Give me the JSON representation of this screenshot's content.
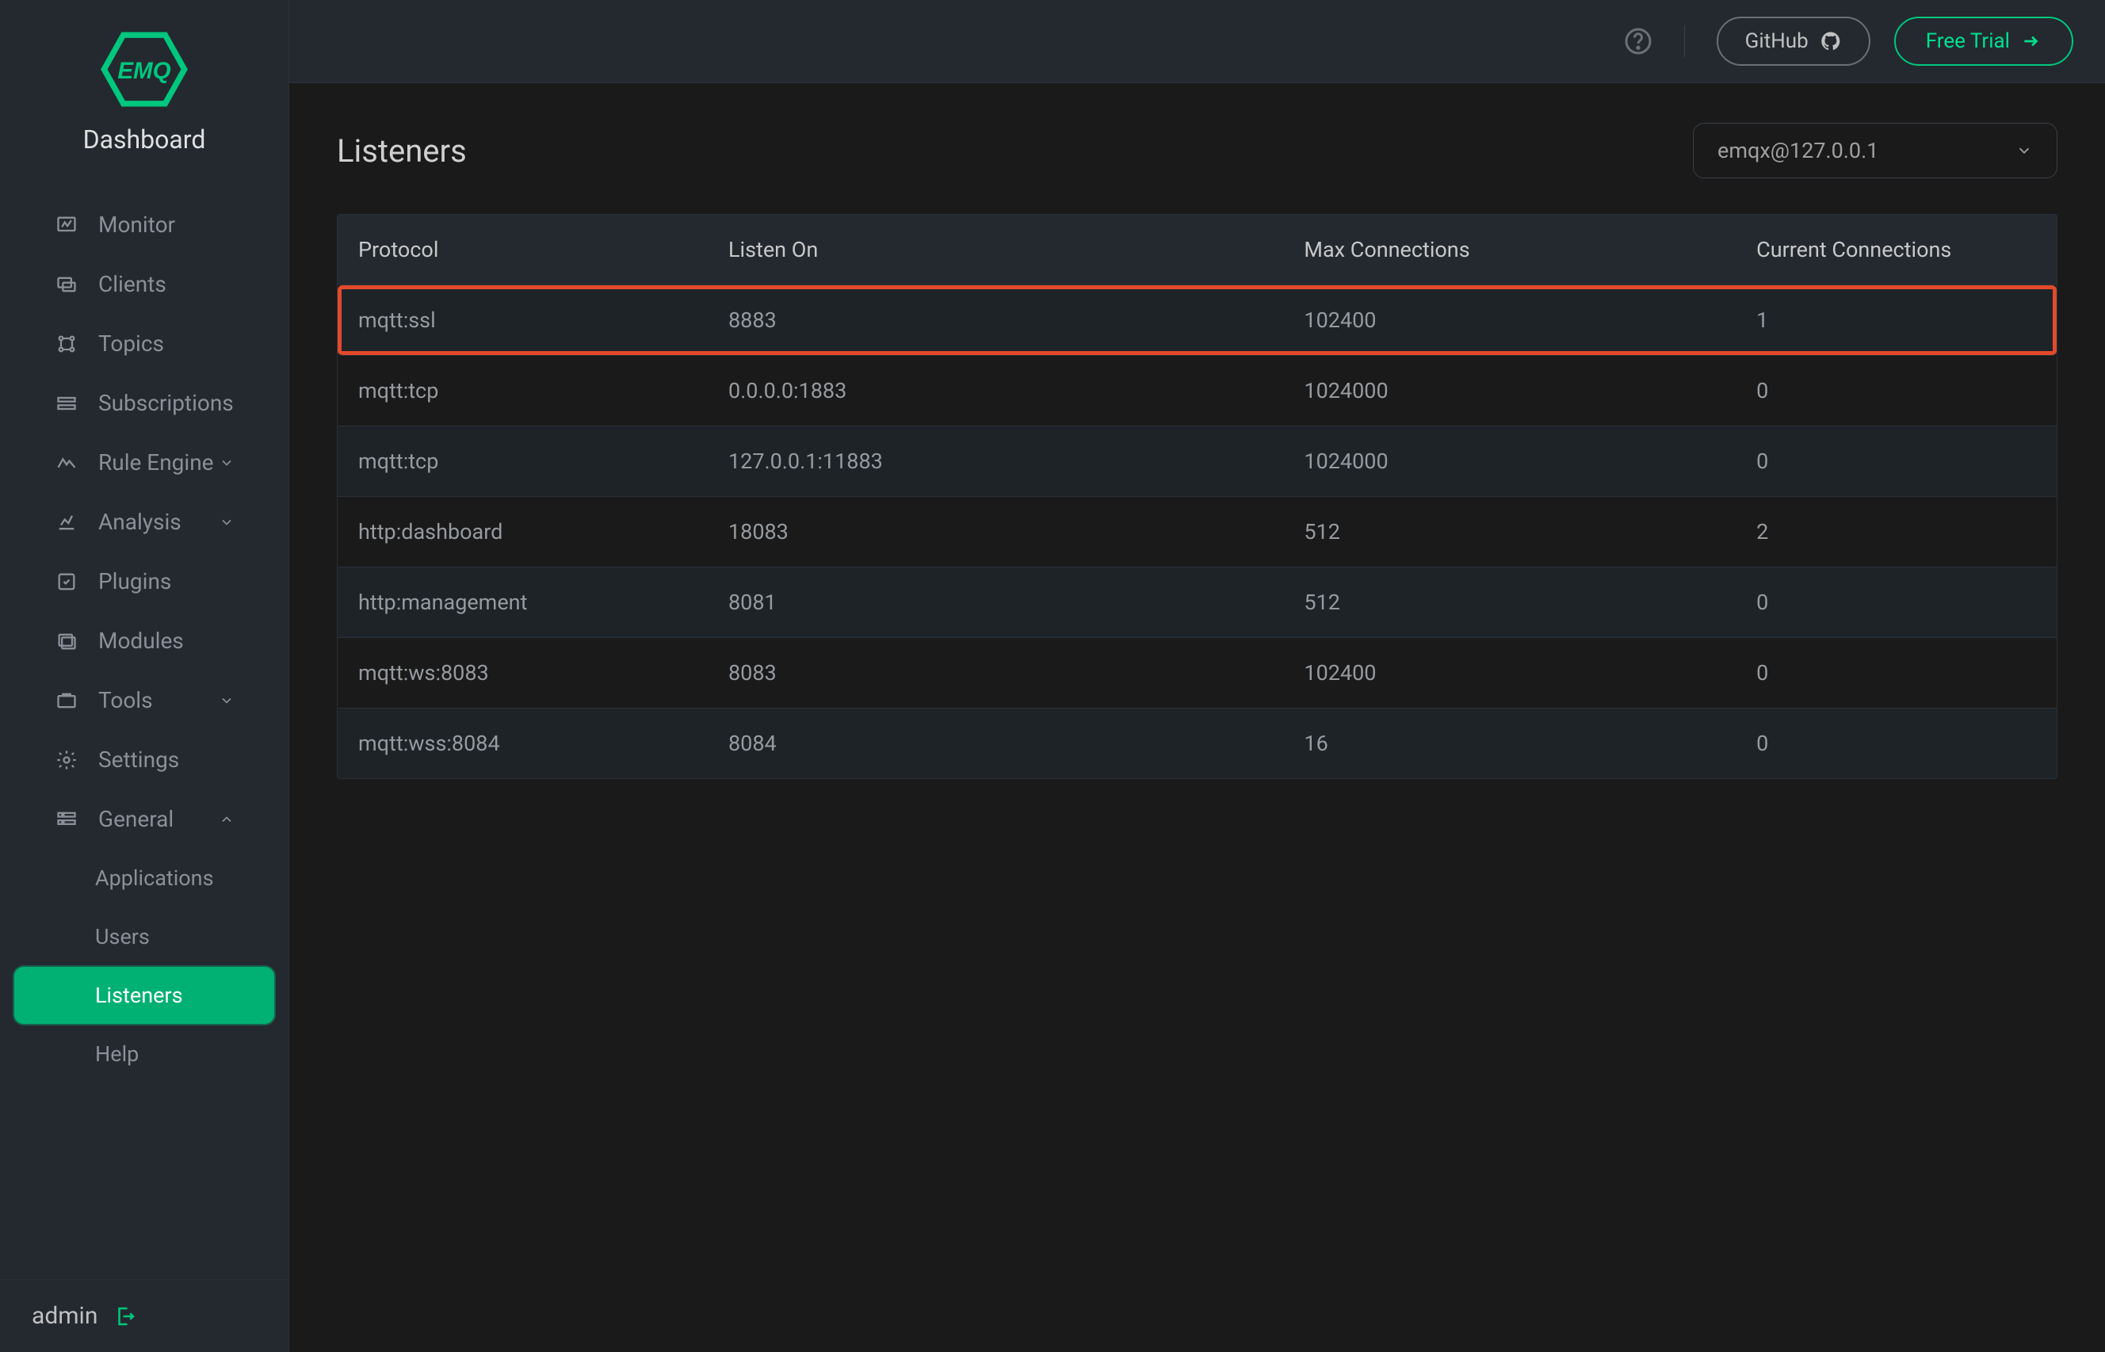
{
  "brand": {
    "logo_text": "EMQ",
    "subtitle": "Dashboard"
  },
  "sidebar": {
    "items": [
      {
        "label": "Monitor",
        "icon": "monitor"
      },
      {
        "label": "Clients",
        "icon": "clients"
      },
      {
        "label": "Topics",
        "icon": "topics"
      },
      {
        "label": "Subscriptions",
        "icon": "subscriptions"
      },
      {
        "label": "Rule Engine",
        "icon": "rule-engine",
        "chevron": "down"
      },
      {
        "label": "Analysis",
        "icon": "analysis",
        "chevron": "down"
      },
      {
        "label": "Plugins",
        "icon": "plugins"
      },
      {
        "label": "Modules",
        "icon": "modules"
      },
      {
        "label": "Tools",
        "icon": "tools",
        "chevron": "down"
      },
      {
        "label": "Settings",
        "icon": "settings"
      },
      {
        "label": "General",
        "icon": "general",
        "chevron": "up"
      }
    ],
    "subitems": [
      {
        "label": "Applications"
      },
      {
        "label": "Users"
      },
      {
        "label": "Listeners",
        "active": true
      },
      {
        "label": "Help"
      }
    ],
    "footer_user": "admin"
  },
  "topbar": {
    "github_label": "GitHub",
    "trial_label": "Free Trial"
  },
  "page": {
    "title": "Listeners",
    "node_selected": "emqx@127.0.0.1"
  },
  "table": {
    "headers": {
      "protocol": "Protocol",
      "listen_on": "Listen On",
      "max_conn": "Max Connections",
      "cur_conn": "Current Connections"
    },
    "rows": [
      {
        "protocol": "mqtt:ssl",
        "listen_on": "8883",
        "max_conn": "102400",
        "cur_conn": "1",
        "highlight": true
      },
      {
        "protocol": "mqtt:tcp",
        "listen_on": "0.0.0.0:1883",
        "max_conn": "1024000",
        "cur_conn": "0"
      },
      {
        "protocol": "mqtt:tcp",
        "listen_on": "127.0.0.1:11883",
        "max_conn": "1024000",
        "cur_conn": "0"
      },
      {
        "protocol": "http:dashboard",
        "listen_on": "18083",
        "max_conn": "512",
        "cur_conn": "2"
      },
      {
        "protocol": "http:management",
        "listen_on": "8081",
        "max_conn": "512",
        "cur_conn": "0"
      },
      {
        "protocol": "mqtt:ws:8083",
        "listen_on": "8083",
        "max_conn": "102400",
        "cur_conn": "0"
      },
      {
        "protocol": "mqtt:wss:8084",
        "listen_on": "8084",
        "max_conn": "16",
        "cur_conn": "0"
      }
    ]
  }
}
